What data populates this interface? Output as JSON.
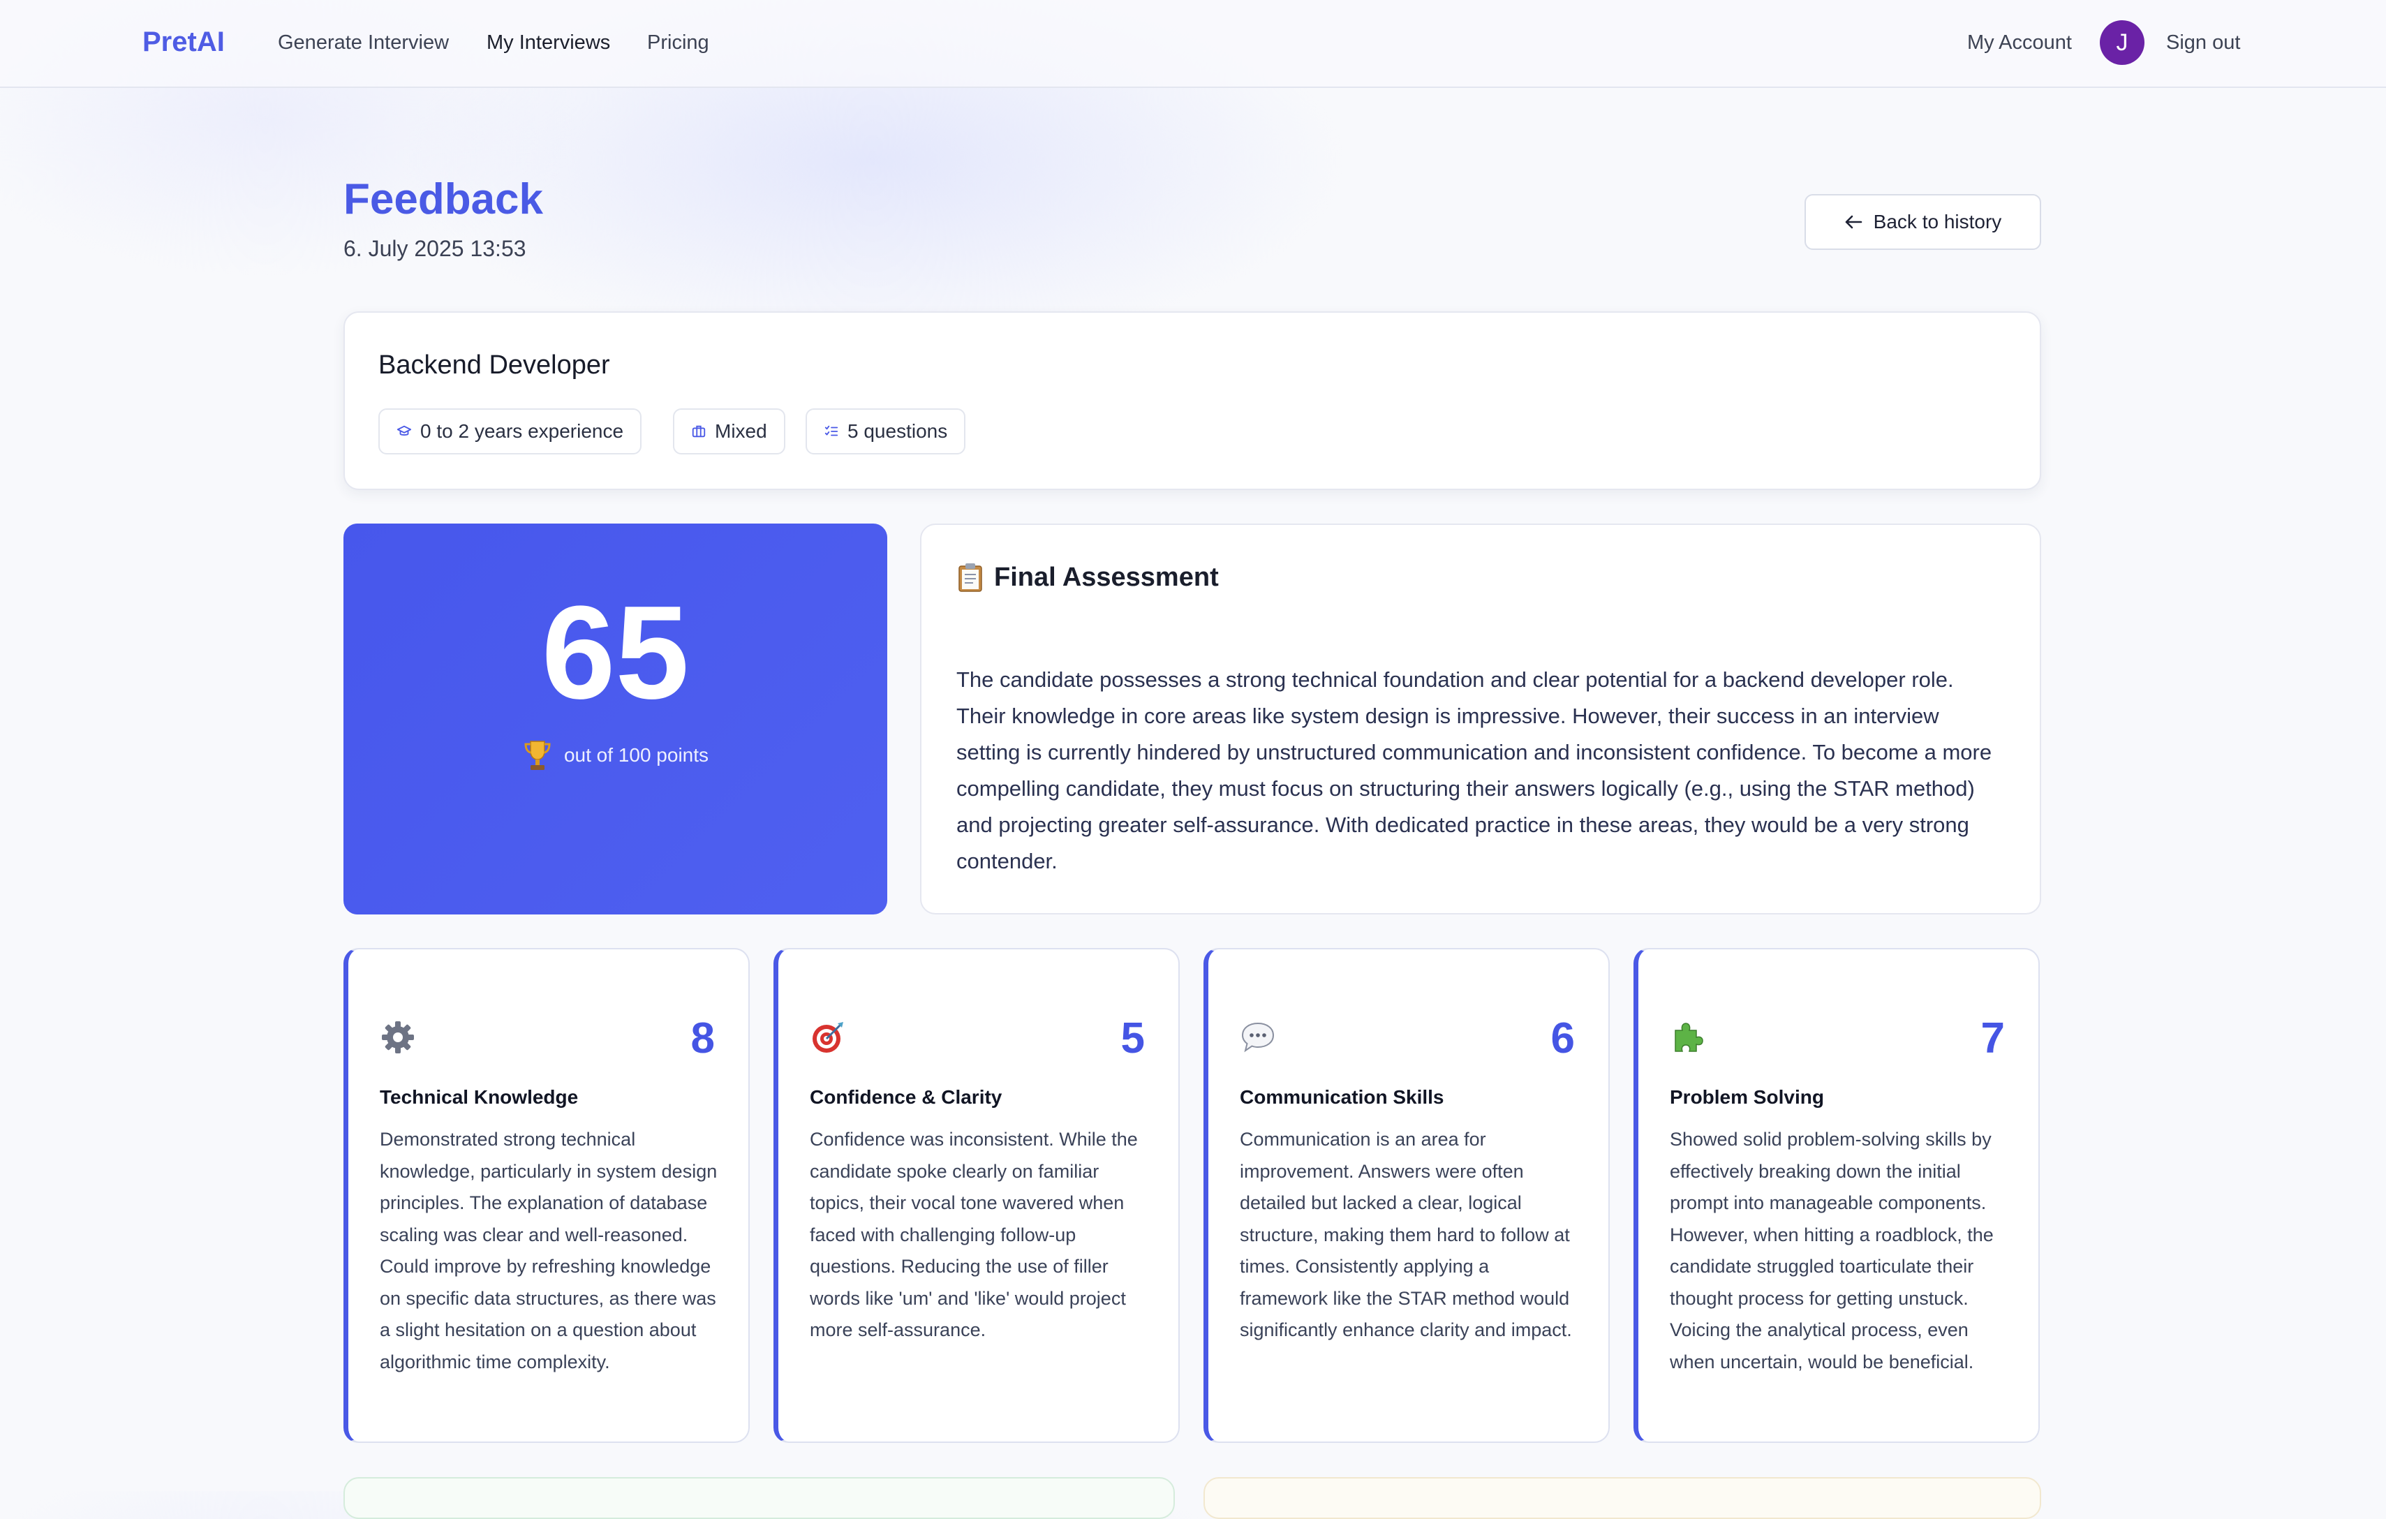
{
  "nav": {
    "brand": "PretAI",
    "links": [
      "Generate Interview",
      "My Interviews",
      "Pricing"
    ],
    "my_account": "My Account",
    "avatar_initial": "J",
    "sign_out": "Sign out"
  },
  "header": {
    "title": "Feedback",
    "date": "6. July 2025 13:53",
    "back_label": "Back to history"
  },
  "interview": {
    "role": "Backend Developer",
    "chips": [
      {
        "icon": "graduation-cap-icon",
        "label": "0 to 2 years experience"
      },
      {
        "icon": "briefcase-icon",
        "label": "Mixed"
      },
      {
        "icon": "list-check-icon",
        "label": "5 questions"
      }
    ]
  },
  "score": {
    "value": "65",
    "icon": "trophy-icon",
    "subtitle": "out of 100 points"
  },
  "assessment": {
    "icon": "clipboard-icon",
    "title": "Final Assessment",
    "text": "The candidate possesses a strong technical foundation and clear potential for a backend developer role. Their knowledge in core areas like system design is impressive. However, their success in an interview setting is currently hindered by unstructured communication and inconsistent confidence. To become a more compelling candidate, they must focus on structuring their answers logically (e.g., using the STAR method) and projecting greater self-assurance. With dedicated practice in these areas, they would be a very strong contender."
  },
  "metrics": [
    {
      "icon": "gear-icon",
      "score": "8",
      "title": "Technical Knowledge",
      "text": "Demonstrated strong technical knowledge, particularly in system design principles. The explanation of database scaling was clear and well-reasoned. Could improve by refreshing knowledge on specific data structures, as there was a slight hesitation on a question about algorithmic time complexity."
    },
    {
      "icon": "target-icon",
      "score": "5",
      "title": "Confidence & Clarity",
      "text": "Confidence was inconsistent. While the candidate spoke clearly on familiar topics, their vocal tone wavered when faced with challenging follow-up questions. Reducing the use of filler words like 'um' and 'like' would project more self-assurance."
    },
    {
      "icon": "speech-bubble-icon",
      "score": "6",
      "title": "Communication Skills",
      "text": "Communication is an area for improvement. Answers were often detailed but lacked a clear, logical structure, making them hard to follow at times. Consistently applying a framework like the STAR method would significantly enhance clarity and impact."
    },
    {
      "icon": "puzzle-piece-icon",
      "score": "7",
      "title": "Problem Solving",
      "text": "Showed solid problem-solving skills by effectively breaking down the initial prompt into manageable components. However, when hitting a roadblock, the candidate struggled toarticulate their thought process for getting unstuck. Voicing the analytical process, even when uncertain, would be beneficial."
    }
  ],
  "colors": {
    "accent": "#4a59e6",
    "avatar": "#6a22a6"
  }
}
